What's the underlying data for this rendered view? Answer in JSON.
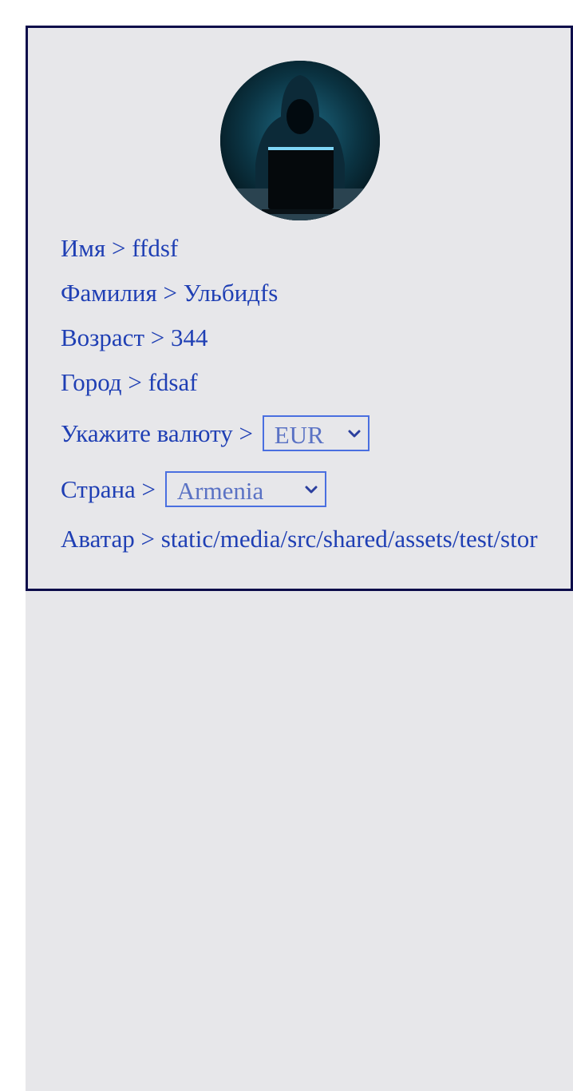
{
  "profile": {
    "avatar_alt": "hacker-avatar",
    "fields": {
      "first_name_label": "Имя >",
      "first_name_value": "ffdsf",
      "last_name_label": "Фамилия >",
      "last_name_value": "Ульбидfs",
      "age_label": "Возраст >",
      "age_value": "344",
      "city_label": "Город >",
      "city_value": "fdsaf",
      "currency_label": "Укажите валюту >",
      "currency_value": "EUR",
      "country_label": "Страна >",
      "country_value": "Armenia",
      "avatar_label": "Аватар >",
      "avatar_value": "static/media/src/shared/assets/test/storybook.jpg"
    }
  },
  "colors": {
    "text": "#1f3fb4",
    "card_border": "#0c0c4a",
    "card_bg": "#e7e7ea",
    "select_border": "#4a6fe0"
  }
}
